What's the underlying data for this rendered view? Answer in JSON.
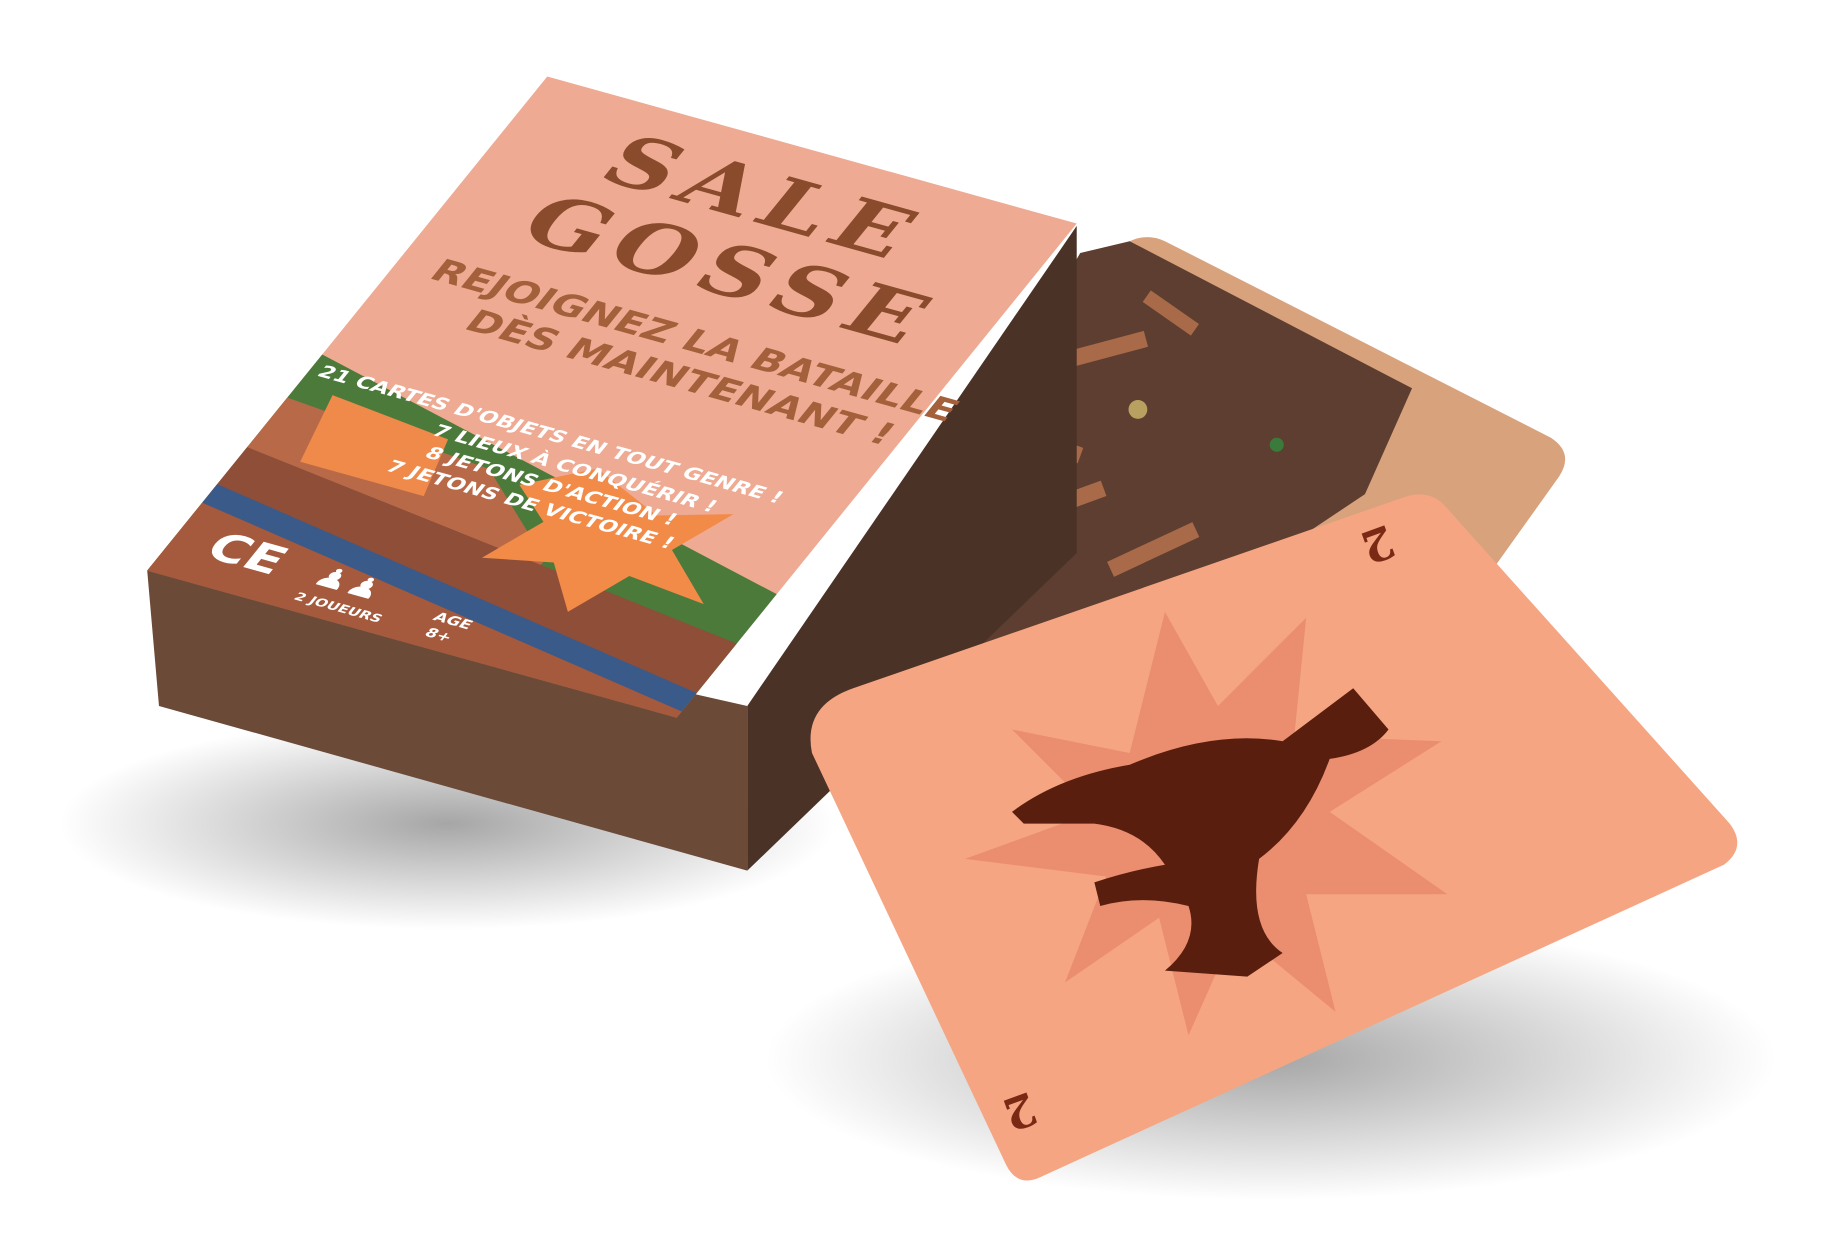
{
  "box": {
    "title_line1": "SALE",
    "title_line2": "GOSSE",
    "tagline_line1": "REJOIGNEZ LA BATAILLE",
    "tagline_line2": "DÈS MAINTENANT !",
    "contents": [
      "21 CARTES D'OBJETS EN TOUT GENRE !",
      "7 LIEUX À CONQUÉRIR !",
      "8 JETONS D'ACTION !",
      "7 JETONS DE VICTOIRE !"
    ],
    "ce_mark": "CE",
    "players": "2 JOUEURS",
    "age_label": "AGE",
    "age_value": "8+"
  },
  "card": {
    "value": "2",
    "illustration": "wolf-silhouette"
  },
  "colors": {
    "box_top": "#eeaa92",
    "box_side": "#4a3226",
    "box_front": "#6b4a38",
    "card_face": "#f5a582",
    "card_back": "#d8a27c",
    "wolf": "#5a1e0e"
  }
}
